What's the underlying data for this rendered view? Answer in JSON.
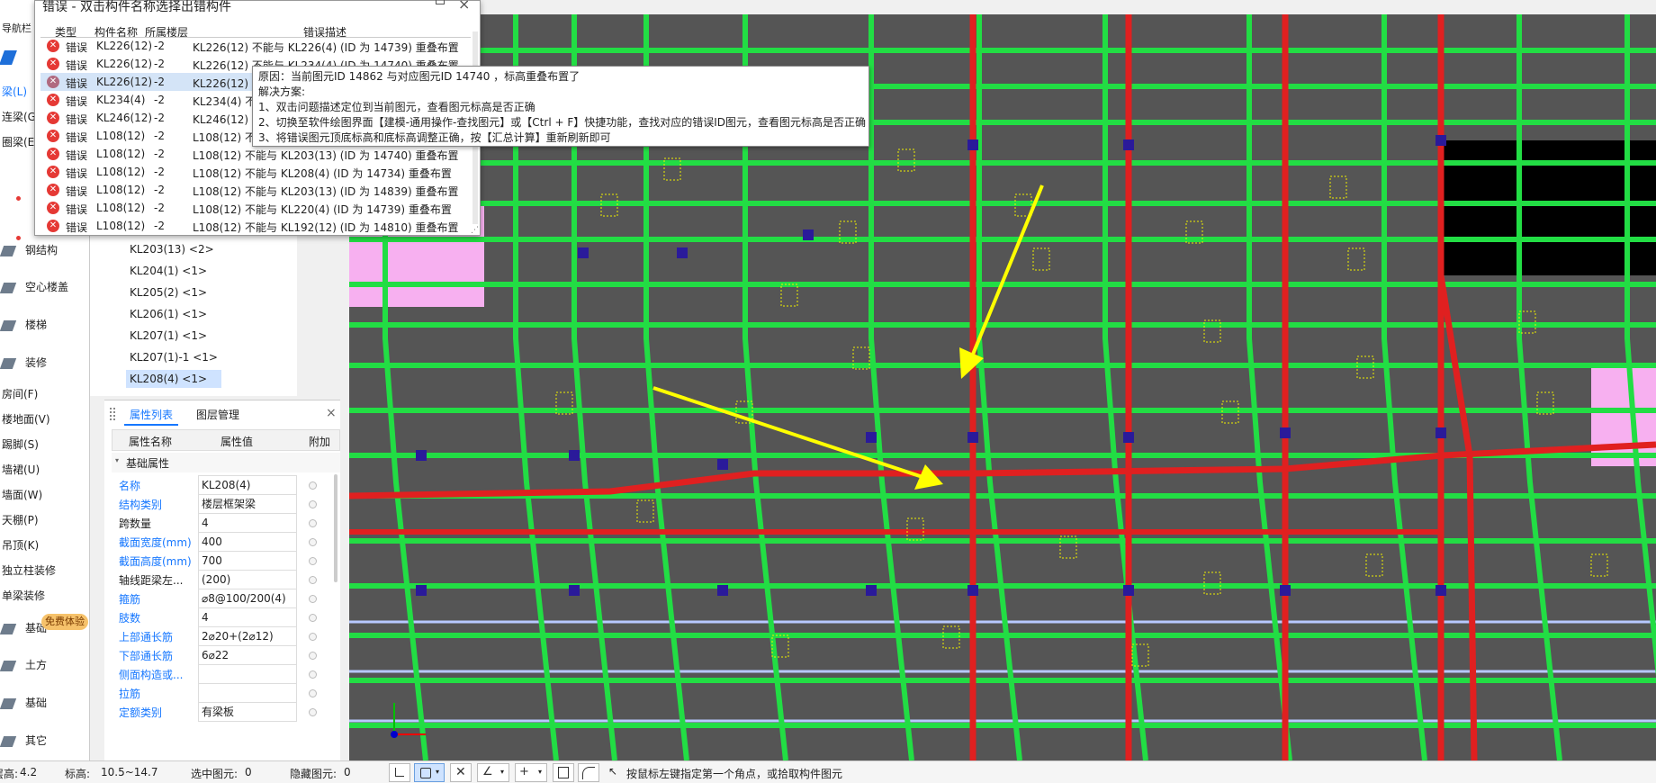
{
  "nav": {
    "header": "导航栏",
    "items": [
      {
        "label": "梁(L)",
        "active": true
      },
      {
        "label": "连梁(G)"
      },
      {
        "label": "圈梁(E)"
      },
      {
        "label": "钢结构"
      },
      {
        "label": "空心楼盖"
      },
      {
        "label": "楼梯"
      },
      {
        "label": "装修"
      },
      {
        "label": "房间(F)"
      },
      {
        "label": "楼地面(V)"
      },
      {
        "label": "踢脚(S)"
      },
      {
        "label": "墙裙(U)"
      },
      {
        "label": "墙面(W)"
      },
      {
        "label": "天棚(P)"
      },
      {
        "label": "吊顶(K)"
      },
      {
        "label": "独立柱装修"
      },
      {
        "label": "单梁装修"
      },
      {
        "label": "基础"
      },
      {
        "label": "土方"
      },
      {
        "label": "基础"
      },
      {
        "label": "其它"
      }
    ],
    "free_trial": "免费体验"
  },
  "tree": {
    "items": [
      "KL203(13) <2>",
      "KL204(1) <1>",
      "KL205(2) <1>",
      "KL206(1) <1>",
      "KL207(1) <1>",
      "KL207(1)-1 <1>",
      "KL208(4) <1>"
    ],
    "selected_index": 6
  },
  "props": {
    "tabs": [
      "属性列表",
      "图层管理"
    ],
    "headers": [
      "属性名称",
      "属性值",
      "附加"
    ],
    "group": "基础属性",
    "rows": [
      {
        "name": "名称",
        "value": "KL208(4)",
        "blue": true
      },
      {
        "name": "结构类别",
        "value": "楼层框架梁",
        "blue": true
      },
      {
        "name": "跨数量",
        "value": "4",
        "blue": false
      },
      {
        "name": "截面宽度(mm)",
        "value": "400",
        "blue": true
      },
      {
        "name": "截面高度(mm)",
        "value": "700",
        "blue": true
      },
      {
        "name": "轴线距梁左...",
        "value": "(200)",
        "blue": false
      },
      {
        "name": "箍筋",
        "value": "⌀8@100/200(4)",
        "blue": true
      },
      {
        "name": "肢数",
        "value": "4",
        "blue": true
      },
      {
        "name": "上部通长筋",
        "value": "2⌀20+(2⌀12)",
        "blue": true
      },
      {
        "name": "下部通长筋",
        "value": "6⌀22",
        "blue": true
      },
      {
        "name": "侧面构造或...",
        "value": "",
        "blue": true
      },
      {
        "name": "拉筋",
        "value": "",
        "blue": true
      },
      {
        "name": "定额类别",
        "value": "有梁板",
        "blue": true
      }
    ]
  },
  "error_dialog": {
    "title": "错误 - 双击构件名称选择出错构件",
    "headers": [
      "类型",
      "构件名称",
      "所属楼层",
      "错误描述"
    ],
    "rows": [
      {
        "type": "错误",
        "name": "KL226(12)",
        "floor": "-2",
        "desc": "KL226(12) 不能与 KL226(4) (ID 为 14739) 重叠布置"
      },
      {
        "type": "错误",
        "name": "KL226(12)",
        "floor": "-2",
        "desc": "KL226(12) 不能与 KL234(4) (ID 为 14740) 重叠布置"
      },
      {
        "type": "错误",
        "name": "KL226(12)",
        "floor": "-2",
        "desc": "KL226(12) 不"
      },
      {
        "type": "错误",
        "name": "KL234(4)",
        "floor": "-2",
        "desc": "KL234(4) 不"
      },
      {
        "type": "错误",
        "name": "KL246(12)",
        "floor": "-2",
        "desc": "KL246(12) 不"
      },
      {
        "type": "错误",
        "name": "L108(12)",
        "floor": "-2",
        "desc": "L108(12) 不"
      },
      {
        "type": "错误",
        "name": "L108(12)",
        "floor": "-2",
        "desc": "L108(12) 不能与 KL203(13) (ID 为 14740) 重叠布置"
      },
      {
        "type": "错误",
        "name": "L108(12)",
        "floor": "-2",
        "desc": "L108(12) 不能与 KL208(4) (ID 为 14734) 重叠布置"
      },
      {
        "type": "错误",
        "name": "L108(12)",
        "floor": "-2",
        "desc": "L108(12) 不能与 KL203(13) (ID 为 14839) 重叠布置"
      },
      {
        "type": "错误",
        "name": "L108(12)",
        "floor": "-2",
        "desc": "L108(12) 不能与 KL220(4) (ID 为 14739) 重叠布置"
      },
      {
        "type": "错误",
        "name": "L108(12)",
        "floor": "-2",
        "desc": "L108(12) 不能与 KL192(12) (ID 为 14810) 重叠布置"
      }
    ],
    "selected_index": 2
  },
  "tooltip": {
    "lines": [
      "原因：当前图元ID 14862 与对应图元ID 14740 ，标高重叠布置了",
      "解决方案:",
      "1、双击问题描述定位到当前图元，查看图元标高是否正确",
      "2、切换至软件绘图界面【建模-通用操作-查找图元】或【Ctrl + F】快捷功能，查找对应的错误ID图元，查看图元标高是否正确",
      "3、将错误图元顶底标高和底标高调整正确，按【汇总计算】重新刷新即可"
    ]
  },
  "status": {
    "floor_height_label": "层高:",
    "floor_height": "4.2",
    "elevation_label": "标高:",
    "elevation": "10.5~14.7",
    "selected_label": "选中图元:",
    "selected": "0",
    "hidden_label": "隐藏图元:",
    "hidden": "0",
    "hint": "按鼠标左键指定第一个角点，或拾取构件图元"
  },
  "colors": {
    "canvas_bg": "#555555",
    "beam_green": "#22dd44",
    "beam_red": "#e02020",
    "column_blue": "#2a1a9a",
    "label_yellow": "#f0f000",
    "arrow_yellow": "#ffff00",
    "pink_area": "#f7b0f0"
  }
}
